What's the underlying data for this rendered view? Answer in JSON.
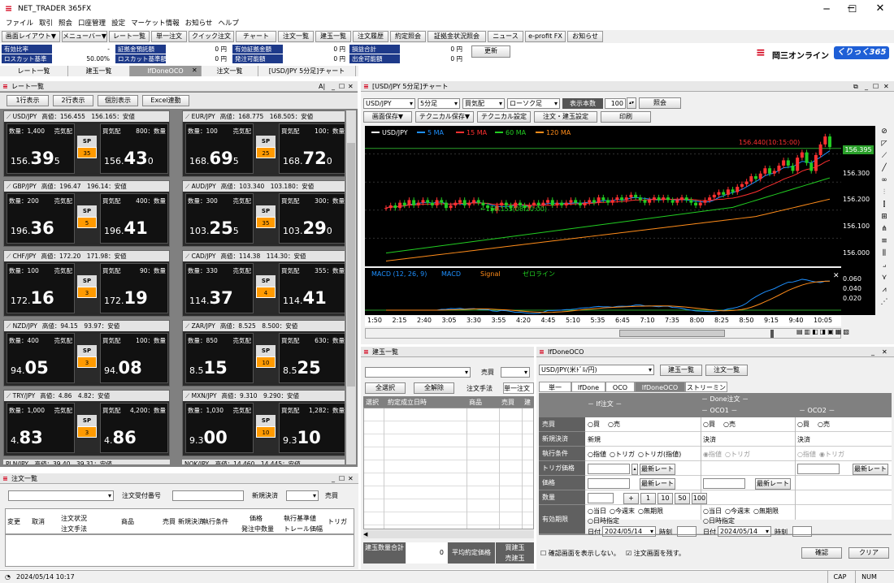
{
  "window": {
    "title": "NET_TRADER 365FX"
  },
  "menu": [
    "ファイル",
    "取引",
    "照会",
    "口座管理",
    "設定",
    "マーケット情報",
    "お知らせ",
    "ヘルプ"
  ],
  "toolbar": [
    "画面レイアウト▼",
    "メニューバー▼",
    "レート一覧",
    "単一注文",
    "クイック注文",
    "チャート",
    "注文一覧",
    "建玉一覧",
    "注文履歴",
    "約定照会",
    "証拠金状況照会",
    "ニュース",
    "e-profit FX",
    "お知らせ"
  ],
  "account": {
    "row1": [
      {
        "label": "有効比率",
        "value": "-"
      },
      {
        "label": "証拠金預託額",
        "value": "0 円"
      },
      {
        "label": "有効証拠金額",
        "value": "0 円"
      },
      {
        "label": "損益合計",
        "value": "0 円"
      }
    ],
    "row2": [
      {
        "label": "ロスカット基準",
        "value": "50.00%"
      },
      {
        "label": "ロスカット基準額",
        "value": "0 円"
      },
      {
        "label": "発注可能額",
        "value": "0 円"
      },
      {
        "label": "出金可能額",
        "value": "0 円"
      }
    ],
    "update_button": "更新"
  },
  "brand": {
    "name": "岡三オンライン",
    "badge": "くりっく365"
  },
  "tabs": [
    "レート一覧",
    "建玉一覧",
    "IfDoneOCO",
    "注文一覧",
    "[USD/JPY 5分足]チャート"
  ],
  "rate_panel": {
    "title": "レート一覧",
    "buttons": [
      "1行表示",
      "2行表示",
      "個別表示",
      "Excel連動"
    ],
    "cards": [
      {
        "pair": "USD/JPY",
        "info": "高値：156.455　156.165：安値",
        "sell_qty": "数量：1,400",
        "buy_qty": "800：数量",
        "sell_big": "39",
        "sell_small": "156.",
        "sell_tail": "5",
        "buy_big": "43",
        "buy_small": "156.",
        "buy_tail": "0",
        "sp": "35"
      },
      {
        "pair": "EUR/JPY",
        "info": "高値：168.775　168.505：安値",
        "sell_qty": "数量：100",
        "buy_qty": "100：数量",
        "sell_big": "69",
        "sell_small": "168.",
        "sell_tail": "5",
        "buy_big": "72",
        "buy_small": "168.",
        "buy_tail": "0",
        "sp": "25"
      },
      {
        "pair": "GBP/JPY",
        "info": "高値：196.47　196.14：安値",
        "sell_qty": "数量：200",
        "buy_qty": "400：数量",
        "sell_big": "36",
        "sell_small": "196.",
        "sell_tail": "",
        "buy_big": "41",
        "buy_small": "196.",
        "buy_tail": "",
        "sp": "5"
      },
      {
        "pair": "AUD/JPY",
        "info": "高値：103.340　103.180：安値",
        "sell_qty": "数量：300",
        "buy_qty": "300：数量",
        "sell_big": "25",
        "sell_small": "103.",
        "sell_tail": "5",
        "buy_big": "29",
        "buy_small": "103.",
        "buy_tail": "0",
        "sp": "35"
      },
      {
        "pair": "CHF/JPY",
        "info": "高値：172.20　171.98：安値",
        "sell_qty": "数量：100",
        "buy_qty": "90：数量",
        "sell_big": "16",
        "sell_small": "172.",
        "sell_tail": "",
        "buy_big": "19",
        "buy_small": "172.",
        "buy_tail": "",
        "sp": "3"
      },
      {
        "pair": "CAD/JPY",
        "info": "高値：114.38　114.30：安値",
        "sell_qty": "数量：330",
        "buy_qty": "355：数量",
        "sell_big": "37",
        "sell_small": "114.",
        "sell_tail": "",
        "buy_big": "41",
        "buy_small": "114.",
        "buy_tail": "",
        "sp": "4"
      },
      {
        "pair": "NZD/JPY",
        "info": "高値：94.15　93.97：安値",
        "sell_qty": "数量：400",
        "buy_qty": "100：数量",
        "sell_big": "05",
        "sell_small": "94.",
        "sell_tail": "",
        "buy_big": "08",
        "buy_small": "94.",
        "buy_tail": "",
        "sp": "3"
      },
      {
        "pair": "ZAR/JPY",
        "info": "高値：8.525　8.500：安値",
        "sell_qty": "数量：850",
        "buy_qty": "630：数量",
        "sell_big": "15",
        "sell_small": "8.5",
        "sell_tail": "",
        "buy_big": "25",
        "buy_small": "8.5",
        "buy_tail": "",
        "sp": "10"
      },
      {
        "pair": "TRY/JPY",
        "info": "高値：4.86　4.82：安値",
        "sell_qty": "数量：1,000",
        "buy_qty": "4,200：数量",
        "sell_big": "83",
        "sell_small": "4.",
        "sell_tail": "",
        "buy_big": "86",
        "buy_small": "4.",
        "buy_tail": "",
        "sp": "3"
      },
      {
        "pair": "MXN/JPY",
        "info": "高値：9.310　9.290：安値",
        "sell_qty": "数量：1,030",
        "buy_qty": "1,282：数量",
        "sell_big": "00",
        "sell_small": "9.3",
        "sell_tail": "",
        "buy_big": "10",
        "buy_small": "9.3",
        "buy_tail": "",
        "sp": "10"
      }
    ],
    "partial": [
      "PLN/JPY　高値：39.40　39.31：安値",
      "NOK/JPY　高値：14.460　14.445：安値"
    ],
    "sell_word": "売気配",
    "buy_word": "買気配",
    "sp_label": "SP"
  },
  "order_panel": {
    "title": "注文一覧",
    "receipt_label": "注文受付番号",
    "new_settle": "新規決済",
    "side": "売買",
    "headers": [
      "変更",
      "取消",
      "注文状況",
      "注文手法",
      "商品",
      "売買",
      "新規決済",
      "執行条件",
      "価格",
      "発注中数量",
      "執行基準値",
      "トレール価幅",
      "トリガ"
    ]
  },
  "chart": {
    "title": "[USD/JPY 5分足]チャート",
    "pair": "USD/JPY",
    "interval": "5分足",
    "price_type": "買気配",
    "candle": "ローソク足",
    "display_count_label": "表示本数",
    "display_count": "100",
    "query": "照会",
    "buttons": [
      "画面保存▼",
      "テクニカル保存▼",
      "テクニカル設定",
      "注文・建玉設定",
      "印刷"
    ],
    "legend": [
      "USD/JPY",
      "5 MA",
      "15 MA",
      "60 MA",
      "120 MA"
    ],
    "legend_colors": [
      "#ffffff",
      "#1e90ff",
      "#ff3030",
      "#22cc22",
      "#ff8c1a"
    ],
    "high_label": "156.440(10:15:00)",
    "low_label": "156.155(08:20:00)",
    "current": "156.395",
    "yticks": [
      "156.300",
      "156.200",
      "156.100",
      "156.000"
    ],
    "macd_legend": [
      "MACD (12, 26, 9)",
      "MACD",
      "Signal",
      "ゼロライン"
    ],
    "macd_ticks": [
      "0.060",
      "0.040",
      "0.020"
    ],
    "xticks": [
      "1:50",
      "2:15",
      "2:40",
      "3:05",
      "3:30",
      "3:55",
      "4:20",
      "4:45",
      "5:10",
      "5:35",
      "6:45",
      "7:10",
      "7:35",
      "8:00",
      "8:25",
      "8:50",
      "9:15",
      "9:40",
      "10:05"
    ]
  },
  "chart_data": {
    "type": "candlestick",
    "symbol": "USD/JPY",
    "interval": "5分足",
    "ylim": [
      155.95,
      156.48
    ],
    "closes": [
      156.17,
      156.18,
      156.17,
      156.19,
      156.18,
      156.2,
      156.18,
      156.19,
      156.2,
      156.19,
      156.18,
      156.2,
      156.19,
      156.17,
      156.18,
      156.19,
      156.2,
      156.18,
      156.19,
      156.2,
      156.19,
      156.18,
      156.17,
      156.16,
      156.18,
      156.19,
      156.18,
      156.17,
      156.19,
      156.18,
      156.17,
      156.18,
      156.19,
      156.18,
      156.19,
      156.2,
      156.18,
      156.19,
      156.18,
      156.19,
      156.2,
      156.19,
      156.18,
      156.19,
      156.2,
      156.19,
      156.21,
      156.2,
      156.19,
      156.2,
      156.21,
      156.2,
      156.21,
      156.22,
      156.21,
      156.2,
      156.19,
      156.2,
      156.21,
      156.2,
      156.21,
      156.2,
      156.19,
      156.2,
      156.21,
      156.2,
      156.19,
      156.18,
      156.19,
      156.2,
      156.21,
      156.22,
      156.23,
      156.22,
      156.24,
      156.23,
      156.25,
      156.26,
      156.27,
      156.29,
      156.28,
      156.3,
      156.32,
      156.3,
      156.31,
      156.33,
      156.35,
      156.33,
      156.31,
      156.36,
      156.38,
      156.34,
      156.31,
      156.37,
      156.41,
      156.44,
      156.4
    ]
  },
  "positions": {
    "title": "建玉一覧",
    "side": "売買",
    "select_all": "全選択",
    "deselect_all": "全解除",
    "order_method": "注文手法",
    "single": "単一注文",
    "headers": [
      "選択",
      "約定成立日時",
      "商品",
      "売買",
      "建"
    ],
    "footer": [
      "建玉数量合計",
      "0",
      "平均約定価格"
    ],
    "footer2": [
      "買建玉",
      "売建玉"
    ]
  },
  "ifdone": {
    "title": "IfDoneOCO",
    "product": "USD/JPY(米ﾄﾞﾙ/円)",
    "buttons": [
      "建玉一覧",
      "注文一覧"
    ],
    "tabs": [
      "単一",
      "IfDone",
      "OCO",
      "IfDoneOCO",
      "ストリーミング"
    ],
    "if_label": "－ If注文 －",
    "done_label": "－ Done注文 －",
    "oco1": "－ OCO1 －",
    "oco2": "－ OCO2 －",
    "rows": [
      "売買",
      "新規決済",
      "執行条件",
      "トリガ価格",
      "価格",
      "数量",
      "有効期限"
    ],
    "buy": "買",
    "sell": "売",
    "new": "新規",
    "settle": "決済",
    "settle2": "決済",
    "cond": [
      "指値",
      "トリガ",
      "トリガ(指値)"
    ],
    "latest": "最新レート",
    "qty_buttons": [
      "+",
      "1",
      "10",
      "50",
      "100"
    ],
    "expiry": [
      "当日",
      "今週末",
      "無期限",
      "日時指定"
    ],
    "date_label": "日付",
    "date": "2024/05/14",
    "time_label": "時刻",
    "confirm_check": "確認画面を表示しない。",
    "keep_check": "注文画面を残す。",
    "confirm": "確認",
    "clear": "クリア"
  },
  "status": {
    "datetime": "2024/05/14 10:17",
    "cap": "CAP",
    "num": "NUM"
  }
}
